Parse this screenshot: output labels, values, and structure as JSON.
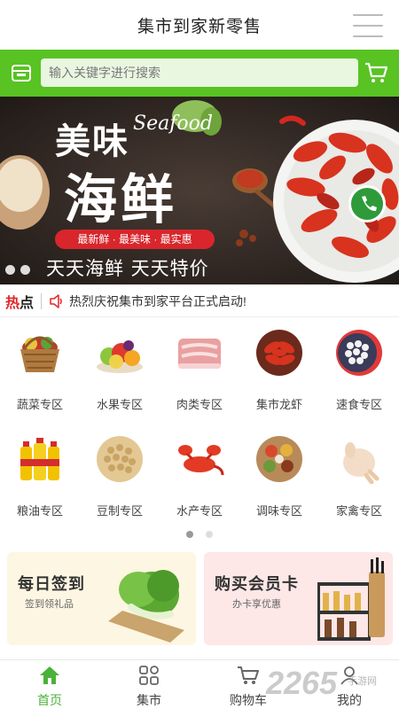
{
  "titlebar": {
    "title": "集市到家新零售"
  },
  "search": {
    "placeholder": "输入关键字进行搜索"
  },
  "banner": {
    "title_line1": "美味",
    "title_script": "Seafood",
    "title_line2": "海鲜",
    "tagline": "最新鲜 · 最美味 · 最实惠",
    "slogan": "天天海鲜  天天特价"
  },
  "notice": {
    "hot_label_1": "热",
    "hot_label_2": "点",
    "text": "热烈庆祝集市到家平台正式启动!"
  },
  "categories": [
    {
      "label": "蔬菜专区",
      "icon": "vegetable-basket-icon"
    },
    {
      "label": "水果专区",
      "icon": "fruit-icon"
    },
    {
      "label": "肉类专区",
      "icon": "meat-icon"
    },
    {
      "label": "集市龙虾",
      "icon": "crayfish-icon"
    },
    {
      "label": "速食专区",
      "icon": "fast-food-icon"
    },
    {
      "label": "粮油专区",
      "icon": "cooking-oil-icon"
    },
    {
      "label": "豆制专区",
      "icon": "soybean-icon"
    },
    {
      "label": "水产专区",
      "icon": "lobster-icon"
    },
    {
      "label": "调味专区",
      "icon": "spices-icon"
    },
    {
      "label": "家禽专区",
      "icon": "poultry-icon"
    }
  ],
  "cards": {
    "sign_in": {
      "title": "每日签到",
      "subtitle": "签到领礼品"
    },
    "member": {
      "title": "购买会员卡",
      "subtitle": "办卡享优惠"
    }
  },
  "tabs": [
    {
      "label": "首页",
      "icon": "home-icon",
      "active": true
    },
    {
      "label": "集市",
      "icon": "market-grid-icon",
      "active": false
    },
    {
      "label": "购物车",
      "icon": "cart-icon",
      "active": false
    },
    {
      "label": "我的",
      "icon": "user-icon",
      "active": false
    }
  ],
  "watermark": {
    "number": "2265",
    "site": "手游网"
  },
  "colors": {
    "brand_green": "#58c322",
    "accent_red": "#e3262b",
    "tab_active": "#4bb13a"
  }
}
